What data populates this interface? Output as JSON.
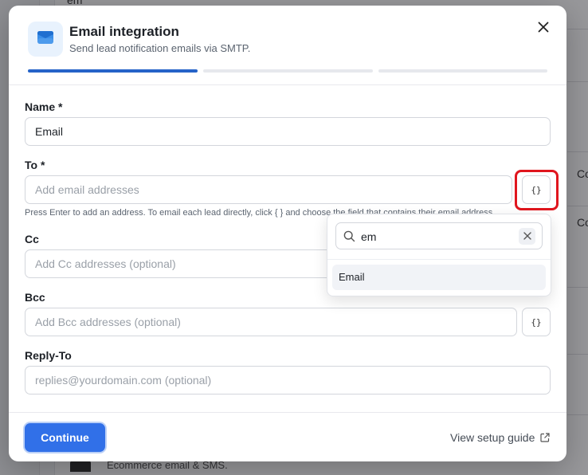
{
  "background": {
    "search_text": "em",
    "right_texts": [
      "Co",
      "Co"
    ],
    "bottom_text": "Ecommerce email & SMS."
  },
  "modal": {
    "title": "Email integration",
    "subtitle": "Send lead notification emails via SMTP.",
    "steps": {
      "current": 1,
      "total": 3
    },
    "fields": {
      "name": {
        "label": "Name *",
        "value": "Email"
      },
      "to": {
        "label": "To *",
        "placeholder": "Add email addresses",
        "hint": "Press Enter to add an address. To email each lead directly, click { } and choose the field that contains their email address."
      },
      "cc": {
        "label": "Cc",
        "placeholder": "Add Cc addresses (optional)"
      },
      "bcc": {
        "label": "Bcc",
        "placeholder": "Add Bcc addresses (optional)"
      },
      "reply_to": {
        "label": "Reply-To",
        "placeholder": "replies@yourdomain.com (optional)"
      }
    },
    "template_button_label": "{}",
    "dropdown": {
      "search_value": "em",
      "options": [
        "Email"
      ]
    },
    "footer": {
      "continue_label": "Continue",
      "setup_guide_label": "View setup guide"
    }
  },
  "colors": {
    "accent": "#3170e8",
    "progress_active": "#2563c8",
    "highlight": "#e0161e"
  },
  "icons": [
    "envelope-icon",
    "close-icon",
    "search-icon",
    "clear-icon",
    "external-link-icon"
  ]
}
